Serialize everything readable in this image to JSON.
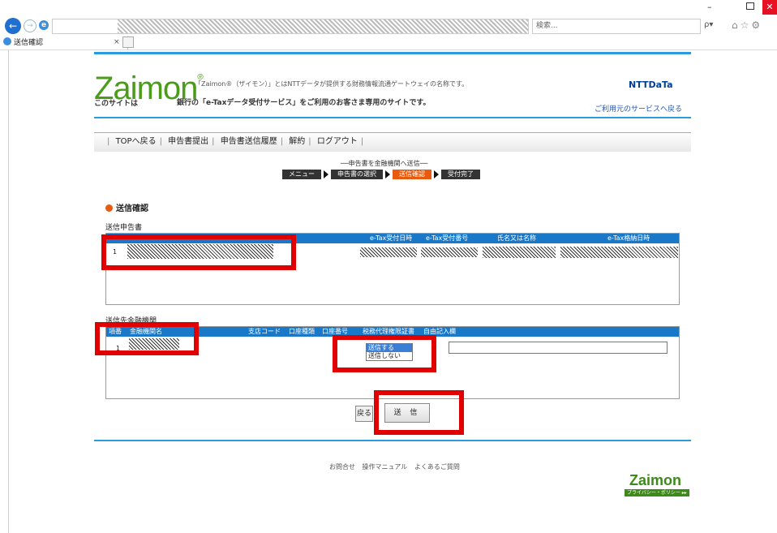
{
  "browser": {
    "search_placeholder": "検索...",
    "tab_title": "送信確認",
    "tab_close": "×",
    "search_btn": "ρ▾",
    "toolbar_icons": "⌂☆⚙",
    "win_min": "–",
    "win_close": "✕"
  },
  "header": {
    "logo": "Zaimon",
    "logo_reg": "®",
    "logo_desc": "「Zaimon®（ザイモン）」とはNTTデータが提供する財務情報流通ゲートウェイの名称です。",
    "site_note": "このサイトは",
    "site_note2": "銀行の「e-Taxデータ受付サービス」をご利用のお客さま専用のサイトです。",
    "brand": "NTTDaTa",
    "service_link": "ご利用元のサービスへ戻る"
  },
  "nav": {
    "items": [
      "TOPへ戻る",
      "申告書提出",
      "申告書送信履歴",
      "解約",
      "ログアウト"
    ]
  },
  "flow": {
    "title": "──申告書を金融機関へ送信──",
    "steps": [
      "メニュー",
      "申告書の選択",
      "送信確認",
      "受付完了"
    ],
    "active": "送信確認"
  },
  "page_title": "送信確認",
  "section1": {
    "label": "送信申告書",
    "columns": [
      "e-Tax受付日時",
      "e-Tax受付番号",
      "氏名又は名称",
      "e-Tax格納日時"
    ],
    "row_no": "1"
  },
  "section2": {
    "label": "送信先金融機関",
    "columns": [
      "項番",
      "金融機関名",
      "支店コード",
      "口座種類",
      "口座番号",
      "税務代理権限証書",
      "自由記入欄"
    ],
    "row_no": "1",
    "select_options": [
      "送信する",
      "送信しない"
    ],
    "select_selected": "送信する",
    "free_text": ""
  },
  "buttons": {
    "back": "戻る",
    "send": "送 信"
  },
  "footer": {
    "links": "お問合せ  操作マニュアル  よくあるご質問",
    "logo": "Zaimon",
    "logo_bar": "プライバシー・ポリシー ▸▸"
  },
  "colors": {
    "accent_blue": "#1a78c8",
    "logo_green": "#4a9c1a",
    "active_step": "#e85a0e",
    "highlight_red": "#e00000"
  }
}
